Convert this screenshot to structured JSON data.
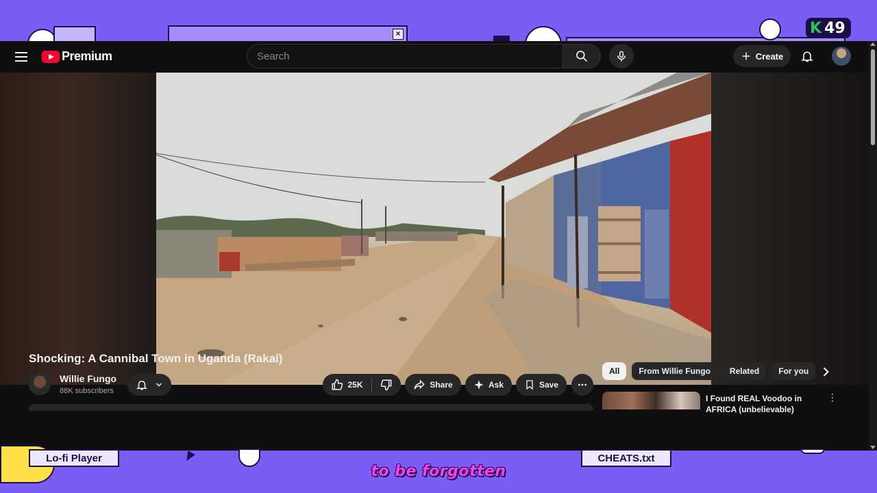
{
  "desktop": {
    "counter_letter": "K",
    "counter_value": "49",
    "taskbar": [
      "Lo-fi Player",
      "CHEATS.txt"
    ],
    "caption": "to be forgotten"
  },
  "header": {
    "logo_text": "Premium",
    "search_placeholder": "Search",
    "create_label": "Create"
  },
  "video": {
    "title": "Shocking: A Cannibal Town in Uganda (Rakai)",
    "channel_name": "Willie Fungo",
    "subscribers": "88K subscribers",
    "like_count": "25K",
    "share_label": "Share",
    "ask_label": "Ask",
    "save_label": "Save"
  },
  "chips": [
    "All",
    "From Willie Fungo",
    "Related",
    "For you"
  ],
  "recommendation": {
    "title": "I Found REAL Voodoo in AFRICA (unbelievable)"
  },
  "colors": {
    "desktop_bg": "#7b5cf5",
    "yt_bg": "#0f0f0f",
    "brand_red": "#ff0033",
    "caption": "#ff3df0"
  }
}
